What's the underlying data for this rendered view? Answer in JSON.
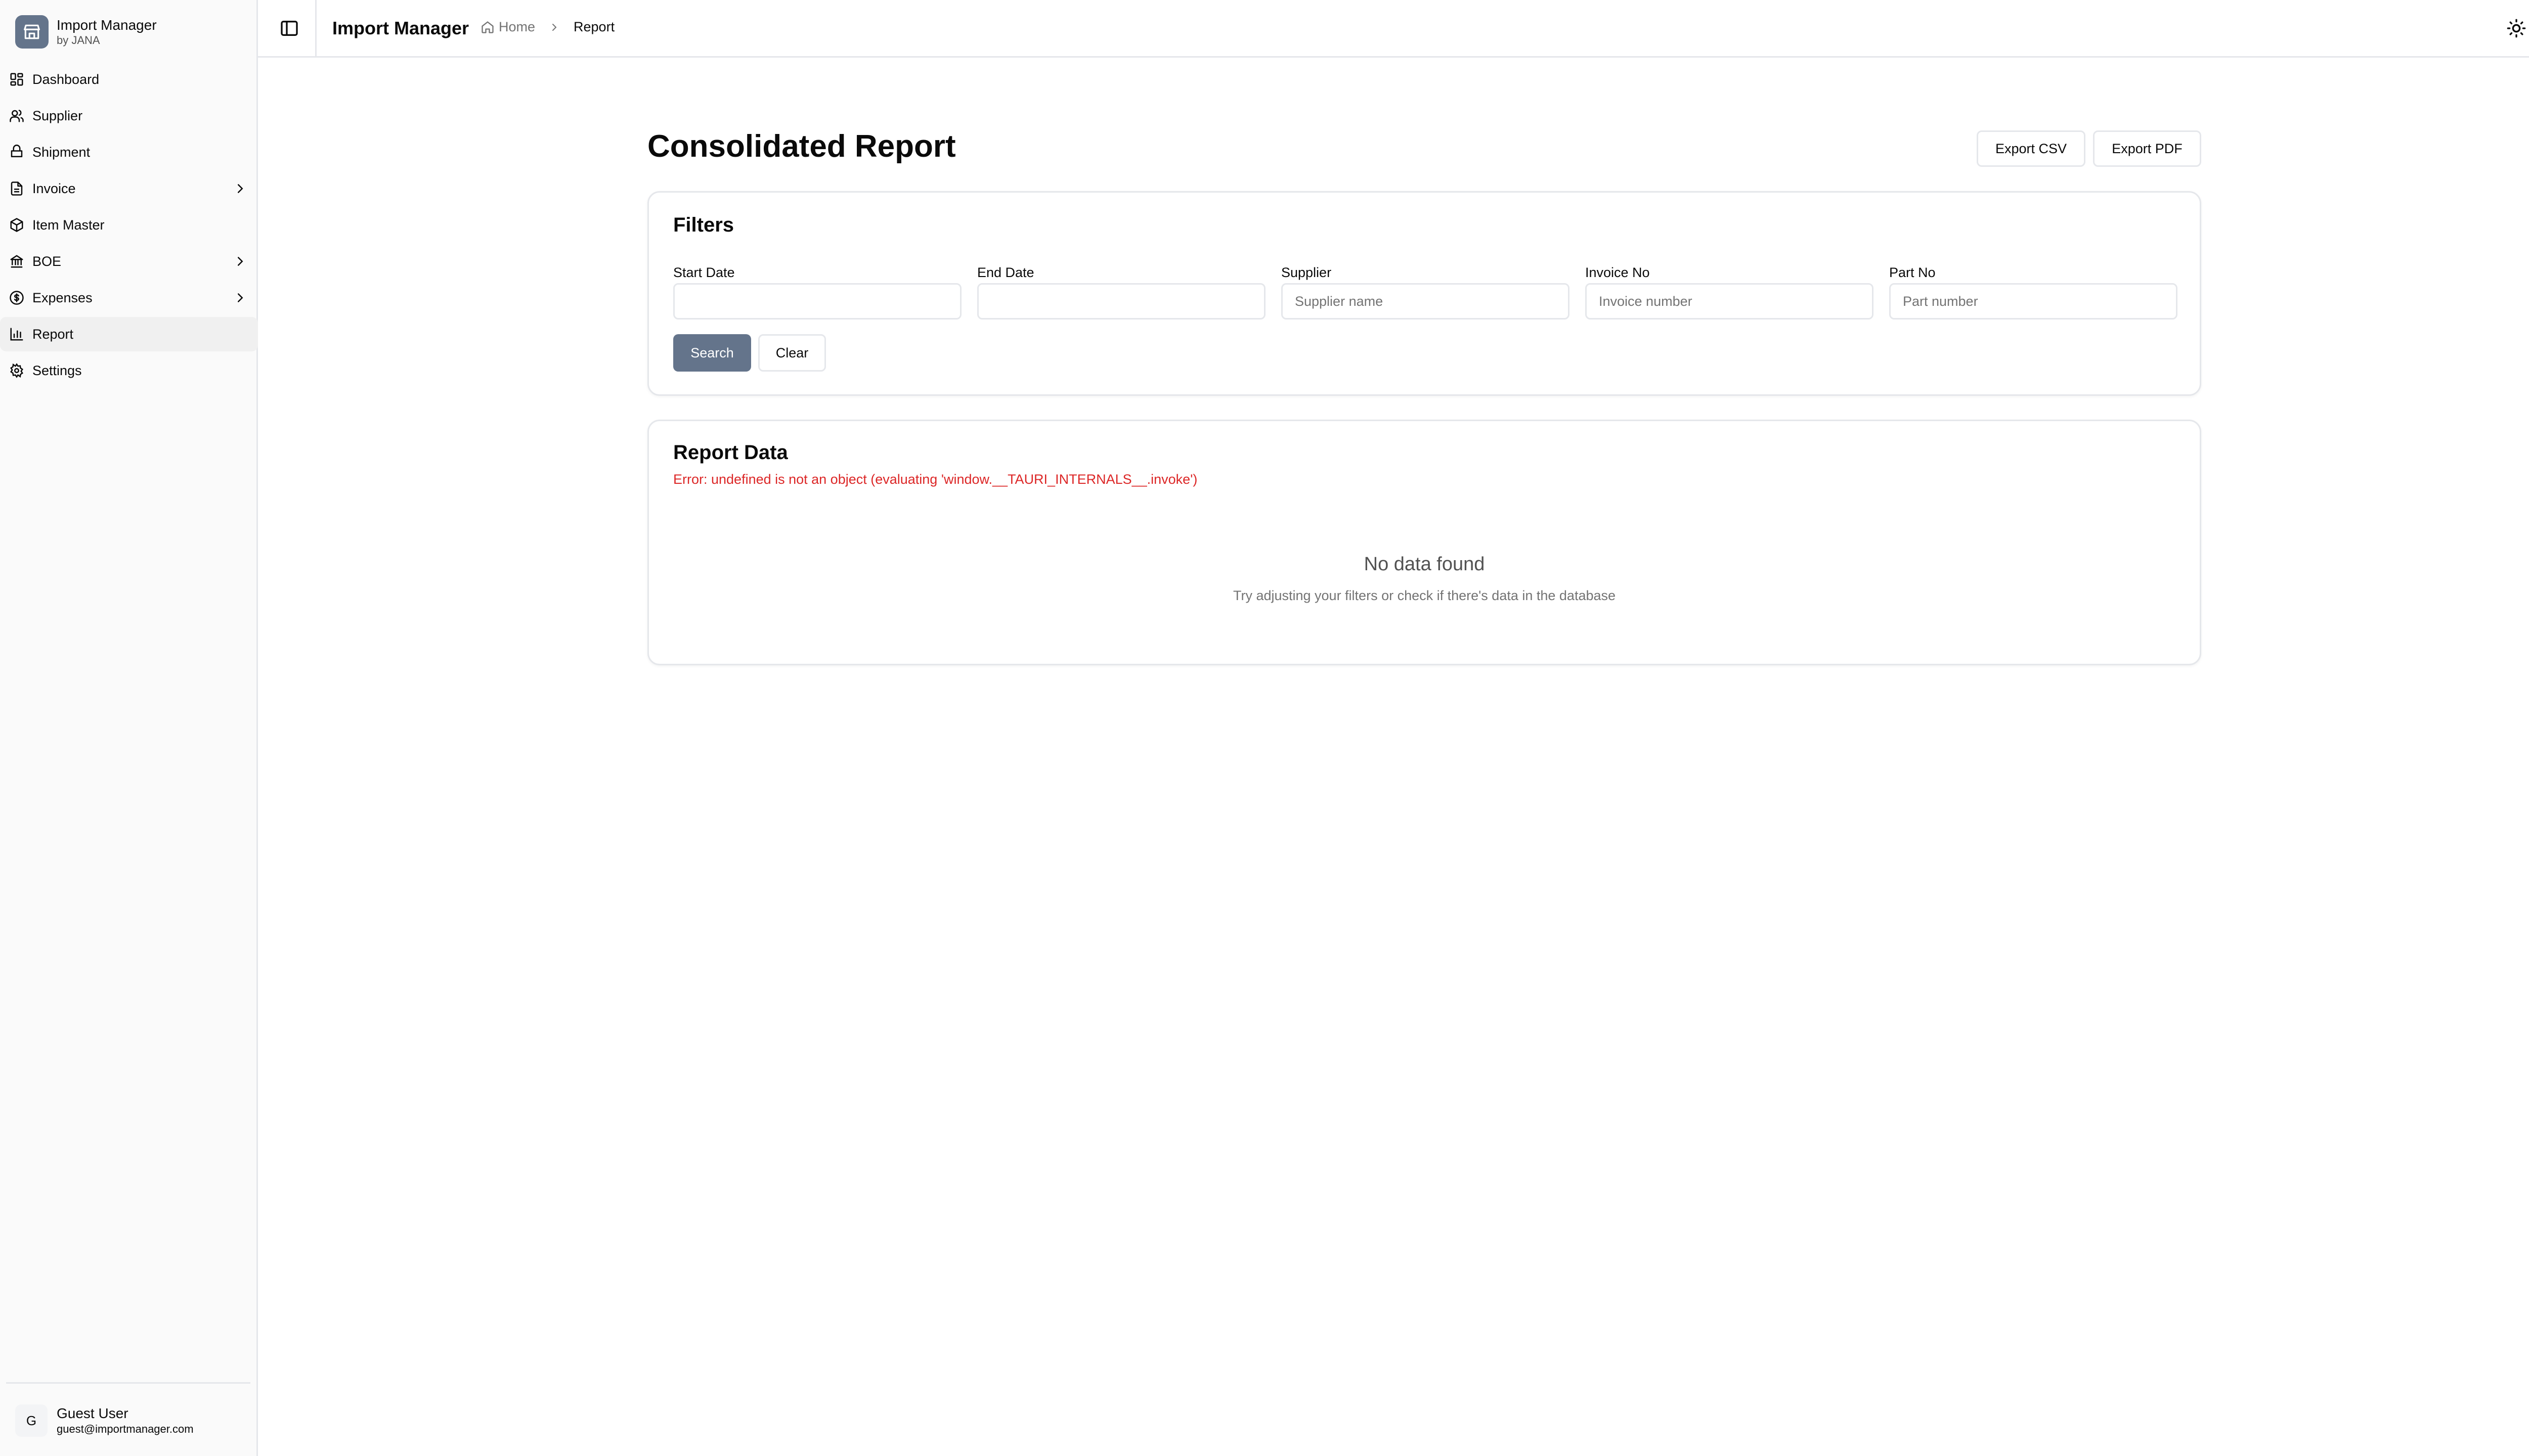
{
  "brand": {
    "title": "Import Manager",
    "subtitle": "by JANA",
    "icon": "store-icon"
  },
  "sidebar": {
    "items": [
      {
        "label": "Dashboard",
        "icon": "dashboard-icon"
      },
      {
        "label": "Supplier",
        "icon": "users-icon"
      },
      {
        "label": "Shipment",
        "icon": "ship-icon"
      },
      {
        "label": "Invoice",
        "icon": "file-icon",
        "expandable": true
      },
      {
        "label": "Item Master",
        "icon": "box-icon"
      },
      {
        "label": "BOE",
        "icon": "landmark-icon",
        "expandable": true
      },
      {
        "label": "Expenses",
        "icon": "dollar-icon",
        "expandable": true
      },
      {
        "label": "Report",
        "icon": "chart-icon",
        "active": true
      },
      {
        "label": "Settings",
        "icon": "gear-icon"
      }
    ]
  },
  "user": {
    "initial": "G",
    "name": "Guest User",
    "email": "guest@importmanager.com"
  },
  "header": {
    "title": "Import Manager",
    "breadcrumb": {
      "home": "Home",
      "current": "Report"
    }
  },
  "page": {
    "title": "Consolidated Report",
    "export_csv": "Export CSV",
    "export_pdf": "Export PDF"
  },
  "filters": {
    "title": "Filters",
    "fields": [
      {
        "label": "Start Date",
        "placeholder": "",
        "value": ""
      },
      {
        "label": "End Date",
        "placeholder": "",
        "value": ""
      },
      {
        "label": "Supplier",
        "placeholder": "Supplier name",
        "value": ""
      },
      {
        "label": "Invoice No",
        "placeholder": "Invoice number",
        "value": ""
      },
      {
        "label": "Part No",
        "placeholder": "Part number",
        "value": ""
      }
    ],
    "search": "Search",
    "clear": "Clear"
  },
  "report": {
    "title": "Report Data",
    "error": "Error: undefined is not an object (evaluating 'window.__TAURI_INTERNALS__.invoke')",
    "empty_title": "No data found",
    "empty_sub": "Try adjusting your filters or check if there's data in the database"
  },
  "colors": {
    "accent": "#64748b",
    "error": "#dc2626",
    "border": "#e5e7eb"
  }
}
